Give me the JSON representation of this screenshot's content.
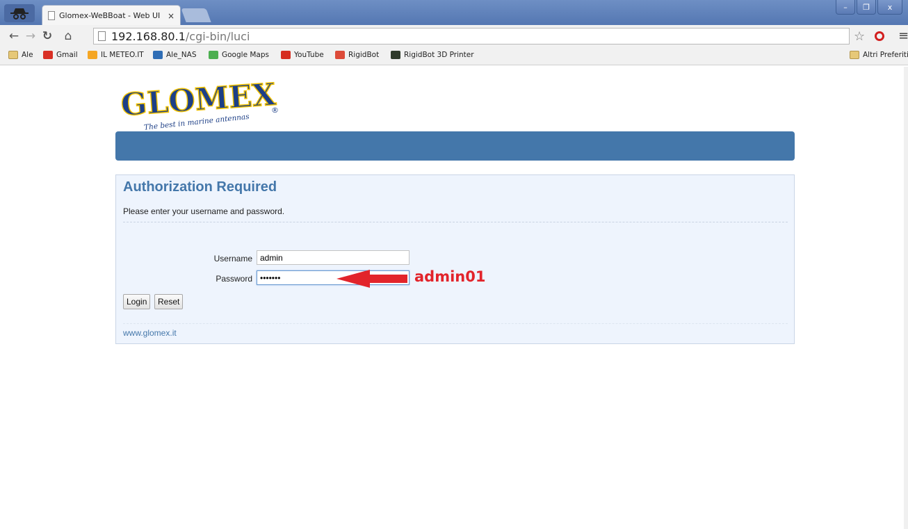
{
  "browser": {
    "tab_title": "Glomex-WeBBoat - Web UI",
    "tab_close": "×",
    "url_host": "192.168.80.1",
    "url_path": "/cgi-bin/luci",
    "window_controls": {
      "minimize": "–",
      "maximize": "❐",
      "close": "x"
    },
    "bookmarks": [
      {
        "label": "Ale",
        "icon": "folder-icon",
        "color": "#e6c878"
      },
      {
        "label": "Gmail",
        "icon": "gmail-icon",
        "color": "#d93025"
      },
      {
        "label": "IL METEO.IT",
        "icon": "meteo-icon",
        "color": "#f5a623"
      },
      {
        "label": "Ale_NAS",
        "icon": "dsm-icon",
        "color": "#2f6db5"
      },
      {
        "label": "Google Maps",
        "icon": "maps-icon",
        "color": "#4caf50"
      },
      {
        "label": "YouTube",
        "icon": "youtube-icon",
        "color": "#d62d20"
      },
      {
        "label": "RigidBot",
        "icon": "googleplus-icon",
        "color": "#dd4b39"
      },
      {
        "label": "RigidBot 3D Printer",
        "icon": "rigidbot-icon",
        "color": "#2e3a2a"
      }
    ],
    "other_bookmarks": "Altri Preferiti"
  },
  "logo": {
    "word": "GLOMEX",
    "tagline": "The best in marine antennas",
    "registered": "®"
  },
  "auth": {
    "title": "Authorization Required",
    "description": "Please enter your username and password.",
    "username_label": "Username",
    "username_value": "admin",
    "password_label": "Password",
    "password_value": "•••••••",
    "login_button": "Login",
    "reset_button": "Reset",
    "footer_link": "www.glomex.it"
  },
  "annotation": {
    "text": "admin01",
    "color": "#e2242b"
  },
  "colors": {
    "accent": "#4477aa",
    "panel_bg": "#eef4fd"
  }
}
